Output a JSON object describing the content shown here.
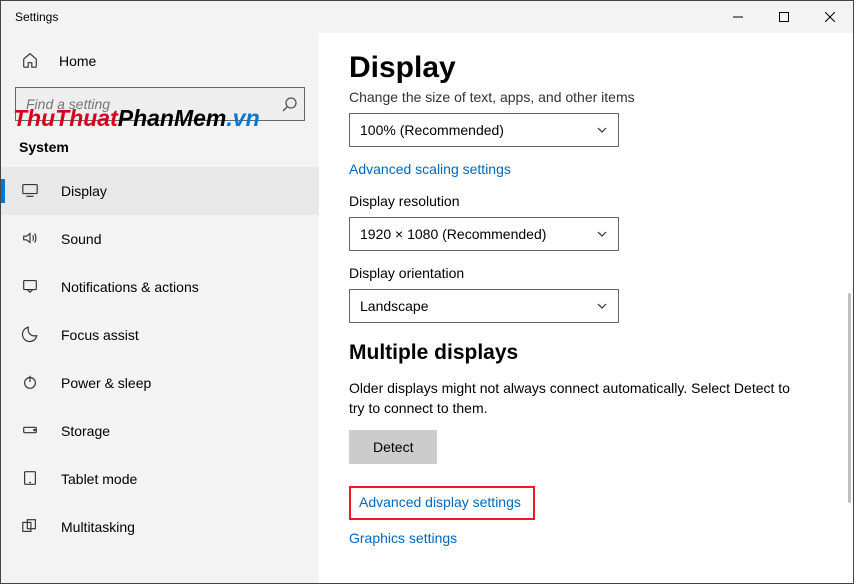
{
  "window": {
    "title": "Settings"
  },
  "sidebar": {
    "home": "Home",
    "search_placeholder": "Find a setting",
    "section": "System",
    "items": [
      {
        "label": "Display"
      },
      {
        "label": "Sound"
      },
      {
        "label": "Notifications & actions"
      },
      {
        "label": "Focus assist"
      },
      {
        "label": "Power & sleep"
      },
      {
        "label": "Storage"
      },
      {
        "label": "Tablet mode"
      },
      {
        "label": "Multitasking"
      }
    ]
  },
  "main": {
    "title": "Display",
    "scale_apps_label": "Change the size of text, apps, and other items",
    "scale_value": "100% (Recommended)",
    "advanced_scaling": "Advanced scaling settings",
    "resolution_label": "Display resolution",
    "resolution_value": "1920 × 1080 (Recommended)",
    "orientation_label": "Display orientation",
    "orientation_value": "Landscape",
    "multi_title": "Multiple displays",
    "multi_desc": "Older displays might not always connect automatically. Select Detect to try to connect to them.",
    "detect_btn": "Detect",
    "advanced_display": "Advanced display settings",
    "graphics_settings": "Graphics settings"
  },
  "watermark": {
    "part1": "ThuThuat",
    "part2": "PhanMem",
    "ext": ".vn"
  }
}
